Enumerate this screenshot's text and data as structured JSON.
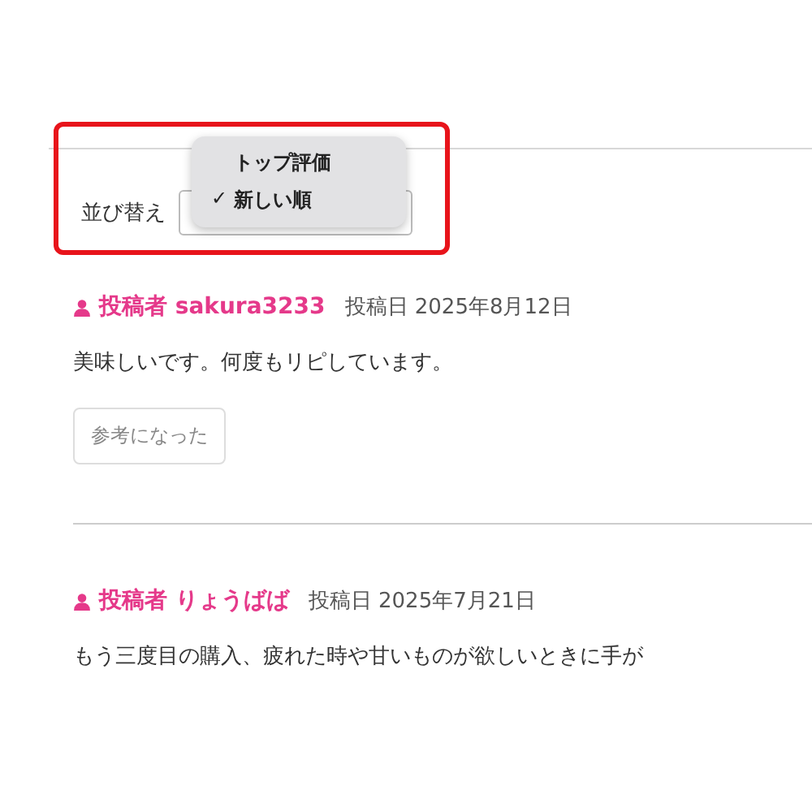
{
  "sort": {
    "label": "並び替え",
    "menu": [
      {
        "label": "トップ評価",
        "selected": false
      },
      {
        "label": "新しい順",
        "selected": true
      }
    ],
    "check": "✓"
  },
  "reviews": [
    {
      "author_label": "投稿者",
      "author": "sakura3233",
      "date_label": "投稿日",
      "date": "2025年8月12日",
      "body": "美味しいです。何度もリピしています。",
      "helpful_button": "参考になった"
    },
    {
      "author_label": "投稿者",
      "author": "りょうばば",
      "date_label": "投稿日",
      "date": "2025年7月21日",
      "body": "もう三度目の購入、疲れた時や甘いものが欲しいときに手が"
    }
  ]
}
